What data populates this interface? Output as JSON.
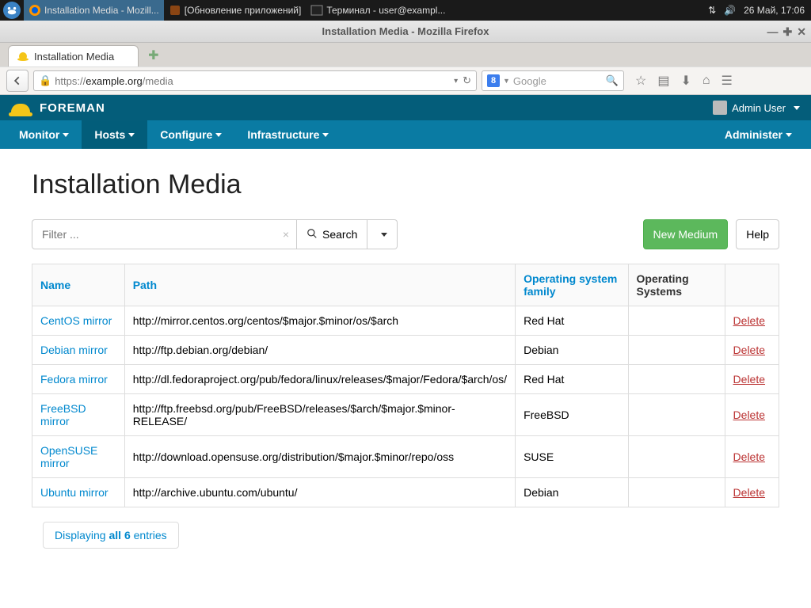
{
  "desktop": {
    "taskbar": [
      {
        "label": "Installation Media - Mozill...",
        "active": true,
        "icon": "firefox"
      },
      {
        "label": "[Обновление приложений]",
        "active": false,
        "icon": "updater"
      },
      {
        "label": "Терминал - user@exampl...",
        "active": false,
        "icon": "terminal"
      }
    ],
    "clock": "26 Май, 17:06"
  },
  "browser": {
    "window_title": "Installation Media - Mozilla Firefox",
    "tab_title": "Installation Media",
    "url_scheme": "https://",
    "url_host": "example.org",
    "url_path": "/media",
    "search_placeholder": "Google"
  },
  "app": {
    "brand": "FOREMAN",
    "user": "Admin User",
    "nav": {
      "monitor": "Monitor",
      "hosts": "Hosts",
      "configure": "Configure",
      "infrastructure": "Infrastructure",
      "administer": "Administer"
    },
    "page_title": "Installation Media",
    "filter_placeholder": "Filter ...",
    "search_btn": "Search",
    "new_btn": "New Medium",
    "help_btn": "Help",
    "columns": {
      "name": "Name",
      "path": "Path",
      "os_family": "Operating system family",
      "os": "Operating Systems"
    },
    "rows": [
      {
        "name": "CentOS mirror",
        "path": "http://mirror.centos.org/centos/$major.$minor/os/$arch",
        "family": "Red Hat",
        "os": "",
        "action": "Delete"
      },
      {
        "name": "Debian mirror",
        "path": "http://ftp.debian.org/debian/",
        "family": "Debian",
        "os": "",
        "action": "Delete"
      },
      {
        "name": "Fedora mirror",
        "path": "http://dl.fedoraproject.org/pub/fedora/linux/releases/$major/Fedora/$arch/os/",
        "family": "Red Hat",
        "os": "",
        "action": "Delete"
      },
      {
        "name": "FreeBSD mirror",
        "path": "http://ftp.freebsd.org/pub/FreeBSD/releases/$arch/$major.$minor-RELEASE/",
        "family": "FreeBSD",
        "os": "",
        "action": "Delete"
      },
      {
        "name": "OpenSUSE mirror",
        "path": "http://download.opensuse.org/distribution/$major.$minor/repo/oss",
        "family": "SUSE",
        "os": "",
        "action": "Delete"
      },
      {
        "name": "Ubuntu mirror",
        "path": "http://archive.ubuntu.com/ubuntu/",
        "family": "Debian",
        "os": "",
        "action": "Delete"
      }
    ],
    "pager_prefix": "Displaying ",
    "pager_bold": "all 6",
    "pager_suffix": " entries"
  }
}
